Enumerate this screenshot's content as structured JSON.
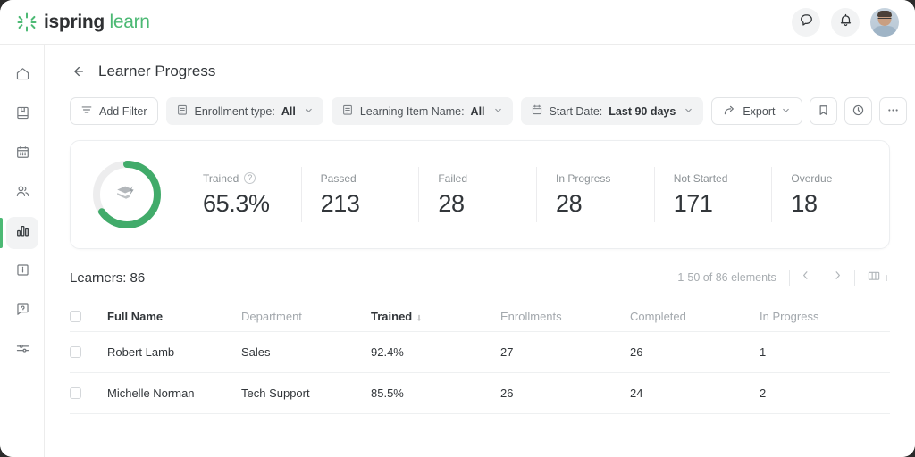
{
  "brand": {
    "name_part1": "ispring",
    "name_part2": "learn",
    "accent_green": "#4cb974",
    "logo_icon": "ispring-starburst-icon"
  },
  "topbar": {
    "chat_icon": "chat-bubble-icon",
    "notifications_icon": "bell-icon",
    "avatar": "user-avatar"
  },
  "sidebar": {
    "items": [
      {
        "name": "home",
        "icon": "home-icon",
        "active": false
      },
      {
        "name": "courses",
        "icon": "book-bookmark-icon",
        "active": false
      },
      {
        "name": "calendar",
        "icon": "calendar-icon",
        "active": false
      },
      {
        "name": "users",
        "icon": "people-icon",
        "active": false
      },
      {
        "name": "reports",
        "icon": "bar-chart-icon",
        "active": true
      },
      {
        "name": "news",
        "icon": "info-box-icon",
        "active": false
      },
      {
        "name": "help",
        "icon": "question-bubble-icon",
        "active": false
      },
      {
        "name": "settings",
        "icon": "sliders-icon",
        "active": false
      }
    ]
  },
  "header": {
    "back_icon": "arrow-left-icon",
    "title": "Learner Progress"
  },
  "filters": {
    "add_filter": {
      "label": "Add Filter",
      "icon": "filter-lines-icon"
    },
    "chips": [
      {
        "label": "Enrollment type: ",
        "value": "All",
        "icon": "list-box-icon"
      },
      {
        "label": "Learning Item Name: ",
        "value": "All",
        "icon": "list-box-icon"
      },
      {
        "label": "Start Date: ",
        "value": "Last 90 days",
        "icon": "calendar-icon"
      }
    ],
    "export": {
      "label": "Export",
      "icon": "share-arrow-icon"
    },
    "bookmark_icon": "bookmark-icon",
    "history_icon": "clock-icon",
    "more_icon": "ellipsis-icon"
  },
  "stats": {
    "donut": {
      "percent": 65.3,
      "arc_color": "#41ab6a",
      "track_color": "#ededee",
      "center_icon": "graduation-stack-lightning-icon"
    },
    "items": [
      {
        "label": "Trained",
        "value": "65.3%",
        "help_icon": "question-circle-icon"
      },
      {
        "label": "Passed",
        "value": "213"
      },
      {
        "label": "Failed",
        "value": "28"
      },
      {
        "label": "In Progress",
        "value": "28"
      },
      {
        "label": "Not Started",
        "value": "171"
      },
      {
        "label": "Overdue",
        "value": "18"
      }
    ]
  },
  "learners": {
    "title": "Learners: 86",
    "pagination": "1-50 of 86 elements",
    "prev_icon": "chevron-left-icon",
    "next_icon": "chevron-right-icon",
    "columns_icon": "columns-icon",
    "columns_plus": "+",
    "columns": [
      "Full Name",
      "Department",
      "Trained",
      "Enrollments",
      "Completed",
      "In Progress"
    ],
    "sort": {
      "column": "Trained",
      "direction": "↓"
    },
    "rows": [
      {
        "full_name": "Robert Lamb",
        "department": "Sales",
        "trained": "92.4%",
        "enrollments": "27",
        "completed": "26",
        "in_progress": "1"
      },
      {
        "full_name": "Michelle Norman",
        "department": "Tech Support",
        "trained": "85.5%",
        "enrollments": "26",
        "completed": "24",
        "in_progress": "2"
      }
    ]
  }
}
